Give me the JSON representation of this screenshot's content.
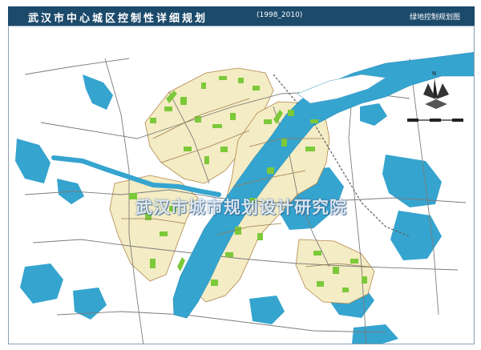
{
  "header": {
    "title": "武汉市中心城区控制性详细规划",
    "years": "(1998_2010)",
    "subtitle": "绿地控制规划图"
  },
  "map": {
    "watermark": "武汉市城市规划设计研究院",
    "north_label": "N",
    "colors": {
      "water": "#35a4cf",
      "built_area": "#f4ecc4",
      "green_space": "#7cc93a",
      "road": "#7c7c7c",
      "title_bar": "#1c4a6b"
    }
  }
}
